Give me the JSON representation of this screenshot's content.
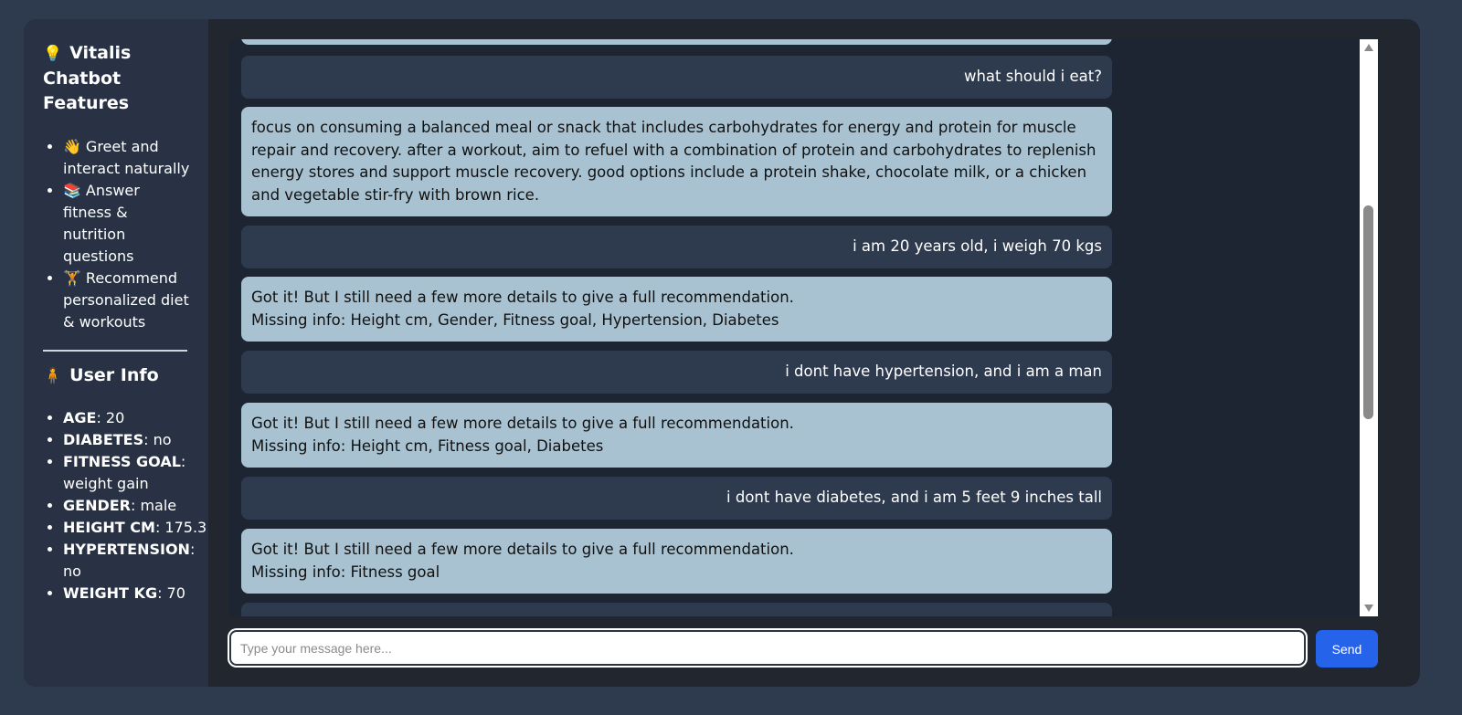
{
  "sidebar": {
    "features_title_icon": "💡",
    "features_title": "Vitalis Chatbot Features",
    "features": [
      {
        "icon": "👋",
        "label": "Greet and interact naturally"
      },
      {
        "icon": "📚",
        "label": "Answer fitness & nutrition questions"
      },
      {
        "icon": "🏋",
        "label": "Recommend personalized diet & workouts"
      }
    ],
    "user_info_icon": "🧍",
    "user_info_title": "User Info",
    "user_info": [
      {
        "key": "AGE",
        "value": ": 20"
      },
      {
        "key": "DIABETES",
        "value": ": no"
      },
      {
        "key": "FITNESS GOAL",
        "value": ": weight gain"
      },
      {
        "key": "GENDER",
        "value": ": male"
      },
      {
        "key": "HEIGHT CM",
        "value": ": 175.3"
      },
      {
        "key": "HYPERTENSION",
        "value": ": no"
      },
      {
        "key": "WEIGHT KG",
        "value": ": 70"
      }
    ]
  },
  "chat": {
    "messages": [
      {
        "role": "user",
        "text": "what should i eat?"
      },
      {
        "role": "bot",
        "lines": [
          "focus on consuming a balanced meal or snack that includes carbohydrates for energy and protein for muscle repair and recovery. after a workout, aim to refuel with a combination of protein and carbohydrates to replenish energy stores and support muscle recovery. good options include a protein shake, chocolate milk, or a chicken and vegetable stir-fry with brown rice."
        ]
      },
      {
        "role": "user",
        "text": "i am 20 years old, i weigh 70 kgs"
      },
      {
        "role": "bot",
        "lines": [
          "Got it! But I still need a few more details to give a full recommendation.",
          "Missing info: Height cm, Gender, Fitness goal, Hypertension, Diabetes"
        ]
      },
      {
        "role": "user",
        "text": "i dont have hypertension, and i am a man"
      },
      {
        "role": "bot",
        "lines": [
          "Got it! But I still need a few more details to give a full recommendation.",
          "Missing info: Height cm, Fitness goal, Diabetes"
        ]
      },
      {
        "role": "user",
        "text": "i dont have diabetes, and i am 5 feet 9 inches tall"
      },
      {
        "role": "bot",
        "lines": [
          "Got it! But I still need a few more details to give a full recommendation.",
          "Missing info: Fitness goal"
        ]
      }
    ]
  },
  "input": {
    "placeholder": "Type your message here...",
    "value": "",
    "send_label": "Send"
  },
  "colors": {
    "page_bg": "#2e3a4e",
    "sidebar_bg": "#283244",
    "user_bubble": "#2e3a4e",
    "bot_bubble": "#a8c2d1",
    "send_button": "#2563eb"
  }
}
